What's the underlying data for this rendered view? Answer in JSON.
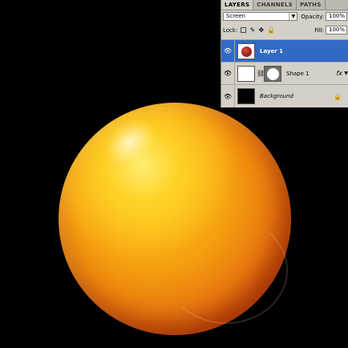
{
  "layers_panel": {
    "tabs": [
      {
        "label": "LAYERS",
        "active": true
      },
      {
        "label": "CHANNELS",
        "active": false
      },
      {
        "label": "PATHS",
        "active": false
      }
    ],
    "blend_mode": "Screen",
    "opacity_label": "Opacity:",
    "opacity_value": "100%",
    "lock_label": "Lock:",
    "fill_label": "Fill:",
    "fill_value": "100%",
    "layers": [
      {
        "name": "Layer 1",
        "selected": true,
        "visible": true
      },
      {
        "name": "Shape 1",
        "selected": false,
        "visible": true,
        "has_fx": true,
        "fx_label": "fx"
      },
      {
        "name": "Background",
        "selected": false,
        "visible": true,
        "locked": true
      }
    ]
  },
  "colors": {
    "accent_selection": "#316ac5",
    "panel_bg": "#d4d0c8",
    "canvas_bg": "#000000"
  }
}
